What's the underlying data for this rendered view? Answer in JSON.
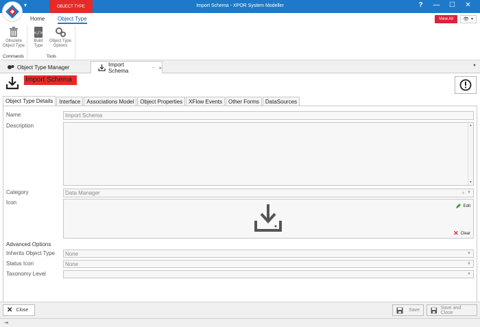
{
  "titlebar": {
    "context_tab": "OBJECT TYPE",
    "window_title": "Import Schema - XPOR System Modeller",
    "help": "?",
    "minimize": "—",
    "maximize": "☐",
    "close": "✕"
  },
  "ribbon": {
    "tabs": [
      {
        "label": "Home"
      },
      {
        "label": "Object Type"
      }
    ],
    "view_all": "View All",
    "groups": {
      "commands": {
        "label": "Commands",
        "buttons": [
          {
            "label": "Obsolete Object Type"
          }
        ]
      },
      "tools": {
        "label": "Tools",
        "buttons": [
          {
            "label": "Build Type"
          },
          {
            "label": "Object Type Options"
          }
        ]
      }
    }
  },
  "doc_tabs": [
    {
      "label": "Object Type Manager"
    },
    {
      "label": "Import Schema"
    }
  ],
  "header": {
    "title": "Import Schema"
  },
  "form_tabs": [
    {
      "label": "Object Type Details"
    },
    {
      "label": "Interface"
    },
    {
      "label": "Associations Model"
    },
    {
      "label": "Object Properties"
    },
    {
      "label": "XFlow Events"
    },
    {
      "label": "Other Forms"
    },
    {
      "label": "DataSources"
    }
  ],
  "form": {
    "name": {
      "label": "Name",
      "value": "Import Schema"
    },
    "description": {
      "label": "Description",
      "value": ""
    },
    "category": {
      "label": "Category",
      "value": "Data Manager"
    },
    "icon": {
      "label": "Icon",
      "edit": "Edit",
      "clear": "Clear"
    },
    "advanced_label": "Advanced Options",
    "inherits": {
      "label": "Inherits Object Type",
      "value": "None"
    },
    "status_icon": {
      "label": "Status Icon",
      "value": "None"
    },
    "taxonomy": {
      "label": "Taxonomy Level",
      "value": ""
    }
  },
  "bottom": {
    "close": "Close",
    "save": "Save",
    "save_close": "Save and Close"
  },
  "colors": {
    "accent": "#1e7ac9",
    "context_tab": "#e52a2a",
    "view_all": "#d9243c"
  }
}
